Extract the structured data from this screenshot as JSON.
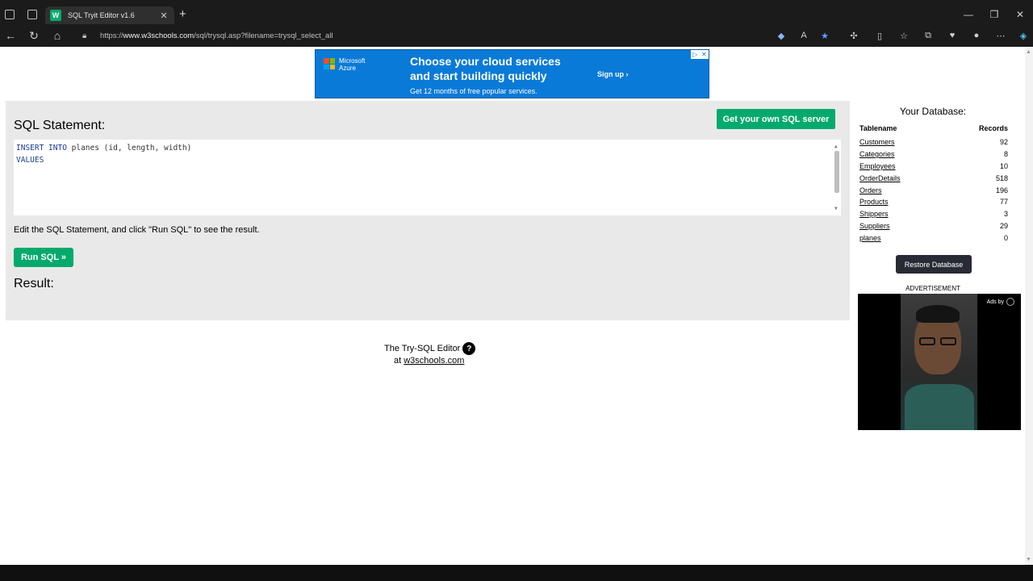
{
  "browser": {
    "tab_title": "SQL Tryit Editor v1.6",
    "tab_favicon": "W",
    "url_scheme": "https://",
    "url_host": "www.w3schools.com",
    "url_path": "/sql/trysql.asp?filename=trysql_select_all"
  },
  "ad_banner": {
    "brand_line1": "Microsoft",
    "brand_line2": "Azure",
    "headline_line1": "Choose your cloud services",
    "headline_line2": "and start building quickly",
    "cta": "Sign up ›",
    "subtext": "Get 12 months of free popular services."
  },
  "editor_panel": {
    "heading": "SQL Statement:",
    "own_server_button": "Get your own SQL server",
    "code": {
      "line1_kw": "INSERT INTO",
      "line1_rest": " planes (id, length, width)",
      "line2_kw": "VALUES"
    },
    "instructions": "Edit the SQL Statement, and click \"Run SQL\" to see the result.",
    "run_button": "Run SQL »",
    "result_heading": "Result:"
  },
  "footer": {
    "line1": "The Try-SQL Editor",
    "help_glyph": "?",
    "line2_prefix": "at ",
    "line2_link": "w3schools.com"
  },
  "database": {
    "title": "Your Database:",
    "col_tablename": "Tablename",
    "col_records": "Records",
    "rows": [
      {
        "name": "Customers",
        "records": "92"
      },
      {
        "name": "Categories",
        "records": "8"
      },
      {
        "name": "Employees",
        "records": "10"
      },
      {
        "name": "OrderDetails",
        "records": "518"
      },
      {
        "name": "Orders",
        "records": "196"
      },
      {
        "name": "Products",
        "records": "77"
      },
      {
        "name": "Shippers",
        "records": "3"
      },
      {
        "name": "Suppliers",
        "records": "29"
      },
      {
        "name": "planes",
        "records": "0"
      }
    ],
    "restore_button": "Restore Database"
  },
  "advertisement": {
    "label": "ADVERTISEMENT",
    "ads_by": "Ads by"
  },
  "colors": {
    "w3_green": "#04aa6d",
    "panel_gray": "#e9e9e9",
    "azure_blue": "#0a7ad8",
    "dark_button": "#282a35"
  }
}
